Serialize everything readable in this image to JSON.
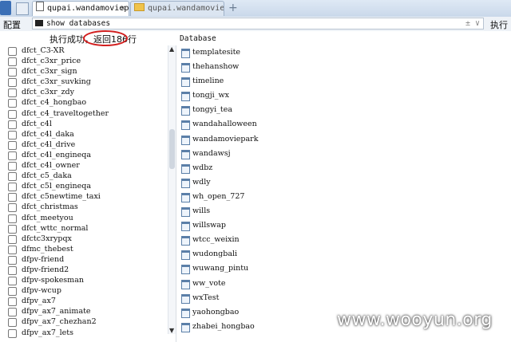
{
  "tabs": [
    {
      "label": "qupai.wandamoviep...",
      "icon": "document-icon",
      "active": true
    },
    {
      "label": "qupai.wandamoviep...",
      "icon": "folder-icon",
      "active": false
    }
  ],
  "new_tab_symbol": "+",
  "close_symbol": "×",
  "command_bar": {
    "config_label": "配置",
    "command_text": "show databases",
    "run_label": "执行",
    "controls": "±  ∨"
  },
  "status": {
    "text": "执行成功，返回186行"
  },
  "results_header": "Database",
  "left_items": [
    "dfct_C3-XR",
    "dfct_c3xr_price",
    "dfct_c3xr_sign",
    "dfct_c3xr_suvking",
    "dfct_c3xr_zdy",
    "dfct_c4_hongbao",
    "dfct_c4_traveltogether",
    "dfct_c4l",
    "dfct_c4l_daka",
    "dfct_c4l_drive",
    "dfct_c4l_engineqa",
    "dfct_c4l_owner",
    "dfct_c5_daka",
    "dfct_c5l_engineqa",
    "dfct_c5newtime_taxi",
    "dfct_christmas",
    "dfct_meetyou",
    "dfct_wttc_normal",
    "dfctc3xrypqx",
    "dfmc_thebest",
    "dfpv-friend",
    "dfpv-friend2",
    "dfpv-spokesman",
    "dfpv-wcup",
    "dfpv_ax7",
    "dfpv_ax7_animate",
    "dfpv_ax7_chezhan2",
    "dfpv_ax7_lets"
  ],
  "right_items": [
    "templatesite",
    "thehanshow",
    "timeline",
    "tongji_wx",
    "tongyi_tea",
    "wandahalloween",
    "wandamoviepark",
    "wandawsj",
    "wdbz",
    "wdly",
    "wh_open_727",
    "wills",
    "willswap",
    "wtcc_weixin",
    "wudongbali",
    "wuwang_pintu",
    "ww_vote",
    "wxTest",
    "yaohongbao",
    "zhabei_hongbao"
  ],
  "watermark": "www.wooyun.org",
  "colors": {
    "highlight": "#d21e1e",
    "tab_bar": "#c9d8ea"
  }
}
